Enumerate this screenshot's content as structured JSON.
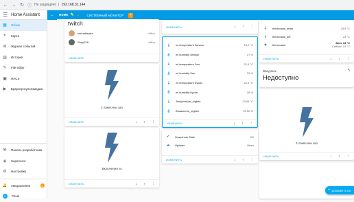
{
  "browser": {
    "back": "←",
    "forward": "→",
    "reload": "↻",
    "security": "Не защищено",
    "host": "192.168.31.144"
  },
  "sidebar": {
    "title": "Home Assistant",
    "items": [
      {
        "label": "Обзор",
        "icon": "view-dashboard-icon",
        "glyph": "▦",
        "active": true
      },
      {
        "label": "Карта",
        "icon": "map-icon",
        "glyph": "⌖"
      },
      {
        "label": "Журнал событий",
        "icon": "logbook-icon",
        "glyph": "≣"
      },
      {
        "label": "История",
        "icon": "history-icon",
        "glyph": "▥"
      },
      {
        "label": "File editor",
        "icon": "wrench-icon",
        "glyph": "✎"
      },
      {
        "label": "HACS",
        "icon": "hacs-icon",
        "glyph": "▣"
      },
      {
        "label": "Браузер мультимедиа",
        "icon": "media-icon",
        "glyph": "▶"
      }
    ],
    "bottom": [
      {
        "label": "Панель разработчика",
        "icon": "hammer-icon",
        "glyph": "⚒"
      },
      {
        "label": "Supervisor",
        "icon": "supervisor-icon",
        "glyph": "◈"
      },
      {
        "label": "Настройки",
        "icon": "settings-icon",
        "glyph": "⚙"
      }
    ],
    "notifications": {
      "label": "Уведомления",
      "count": "1",
      "icon": "bell-icon",
      "glyph": "🔔"
    },
    "user": {
      "label": "Pavel",
      "initial": "P"
    }
  },
  "header": {
    "home_tab": "HOME",
    "monitor_tab": "СИСТЕМНЫЙ МОНИТОР",
    "arrow": "→",
    "pencil": "✎",
    "plus": "+"
  },
  "twitch": {
    "title": "twitch",
    "users": [
      {
        "name": "karinakisada",
        "status": "offline",
        "color": "#d7a27a"
      },
      {
        "name": "Shay228",
        "status": "offline",
        "color": "#5d6d5b"
      }
    ],
    "edit": "ИЗМЕНИТЬ"
  },
  "bolt1": {
    "label": "2 лампочки зал",
    "edit": "ИЗМЕНИТЬ"
  },
  "bolt2": {
    "label": "Включения пк",
    "edit": "ИЗМЕНИТЬ"
  },
  "sensors": {
    "edit_top": "ИЗМЕНИТЬ",
    "rows": [
      {
        "label": "mi temperature балкон",
        "value": "18,2 °C"
      },
      {
        "label": "mi humidity балкон",
        "value": "27 %"
      },
      {
        "label": "mi temperature Зал",
        "value": "21,5 °C"
      },
      {
        "label": "mi humidity Зал",
        "value": "29 %"
      },
      {
        "label": "mi temperature Кухня",
        "value": "22,5 °C"
      },
      {
        "label": "mi humidity Кухня",
        "value": "28 %"
      },
      {
        "label": "Temperature_zigbee",
        "value": "23,64 °C"
      },
      {
        "label": "Влажность_zigbee",
        "value": "25,52 %"
      }
    ],
    "edit": "ИЗМЕНИТЬ"
  },
  "status": {
    "rows": [
      {
        "label": "Snapshots Stale",
        "value": "OK"
      },
      {
        "label": "Updater",
        "value": "Выкл"
      }
    ],
    "edit": "ИЗМЕНИТЬ"
  },
  "thermo": {
    "rows": [
      {
        "label": "thermostat_temp",
        "value": "23,5 °C"
      },
      {
        "label": "thermostat_set",
        "value": "23 °C"
      },
      {
        "label": "thermostat",
        "value": "Авто 34 °C",
        "sub": "Сейчас: 23 °C"
      }
    ],
    "edit": "ИЗМЕНИТЬ"
  },
  "unavail": {
    "name": "Вакуумок",
    "state": "Недоступно"
  },
  "bolt3": {
    "label": "3 лампочки зал",
    "edit": "ИЗМЕНИТЬ"
  },
  "fab": {
    "label": "ДОБАВИТЬ КА"
  },
  "colors": {
    "accent": "#03a9f4",
    "header": "#039be5",
    "icon": "#44739e",
    "bolt": "#44739e"
  }
}
